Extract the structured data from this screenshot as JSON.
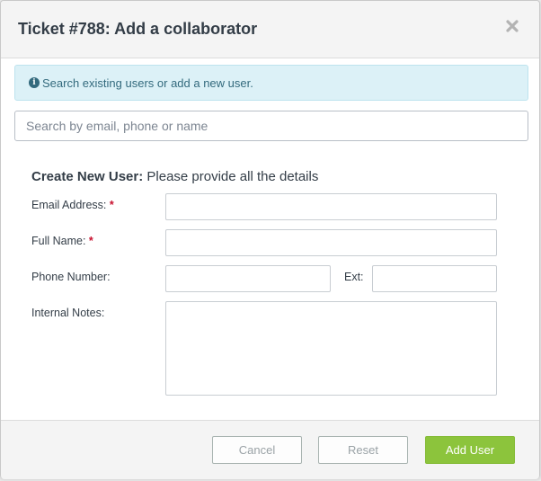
{
  "dialog": {
    "title": "Ticket #788: Add a collaborator",
    "close_icon": "close-icon"
  },
  "info": {
    "icon": "info-circle-icon",
    "text": "Search existing users or add a new user."
  },
  "search": {
    "placeholder": "Search by email, phone or name",
    "value": ""
  },
  "form": {
    "section_title_bold": "Create New User:",
    "section_title_rest": " Please provide all the details",
    "email_label": "Email Address:",
    "name_label": "Full Name:",
    "phone_label": "Phone Number:",
    "ext_label": "Ext:",
    "notes_label": "Internal Notes:",
    "required_marker": "*",
    "email_value": "",
    "name_value": "",
    "phone_value": "",
    "ext_value": "",
    "notes_value": ""
  },
  "footer": {
    "cancel_label": "Cancel",
    "reset_label": "Reset",
    "add_user_label": "Add User"
  },
  "colors": {
    "primary_button": "#8cc43c",
    "info_background": "#dcf1f7",
    "required": "#c8102e"
  }
}
